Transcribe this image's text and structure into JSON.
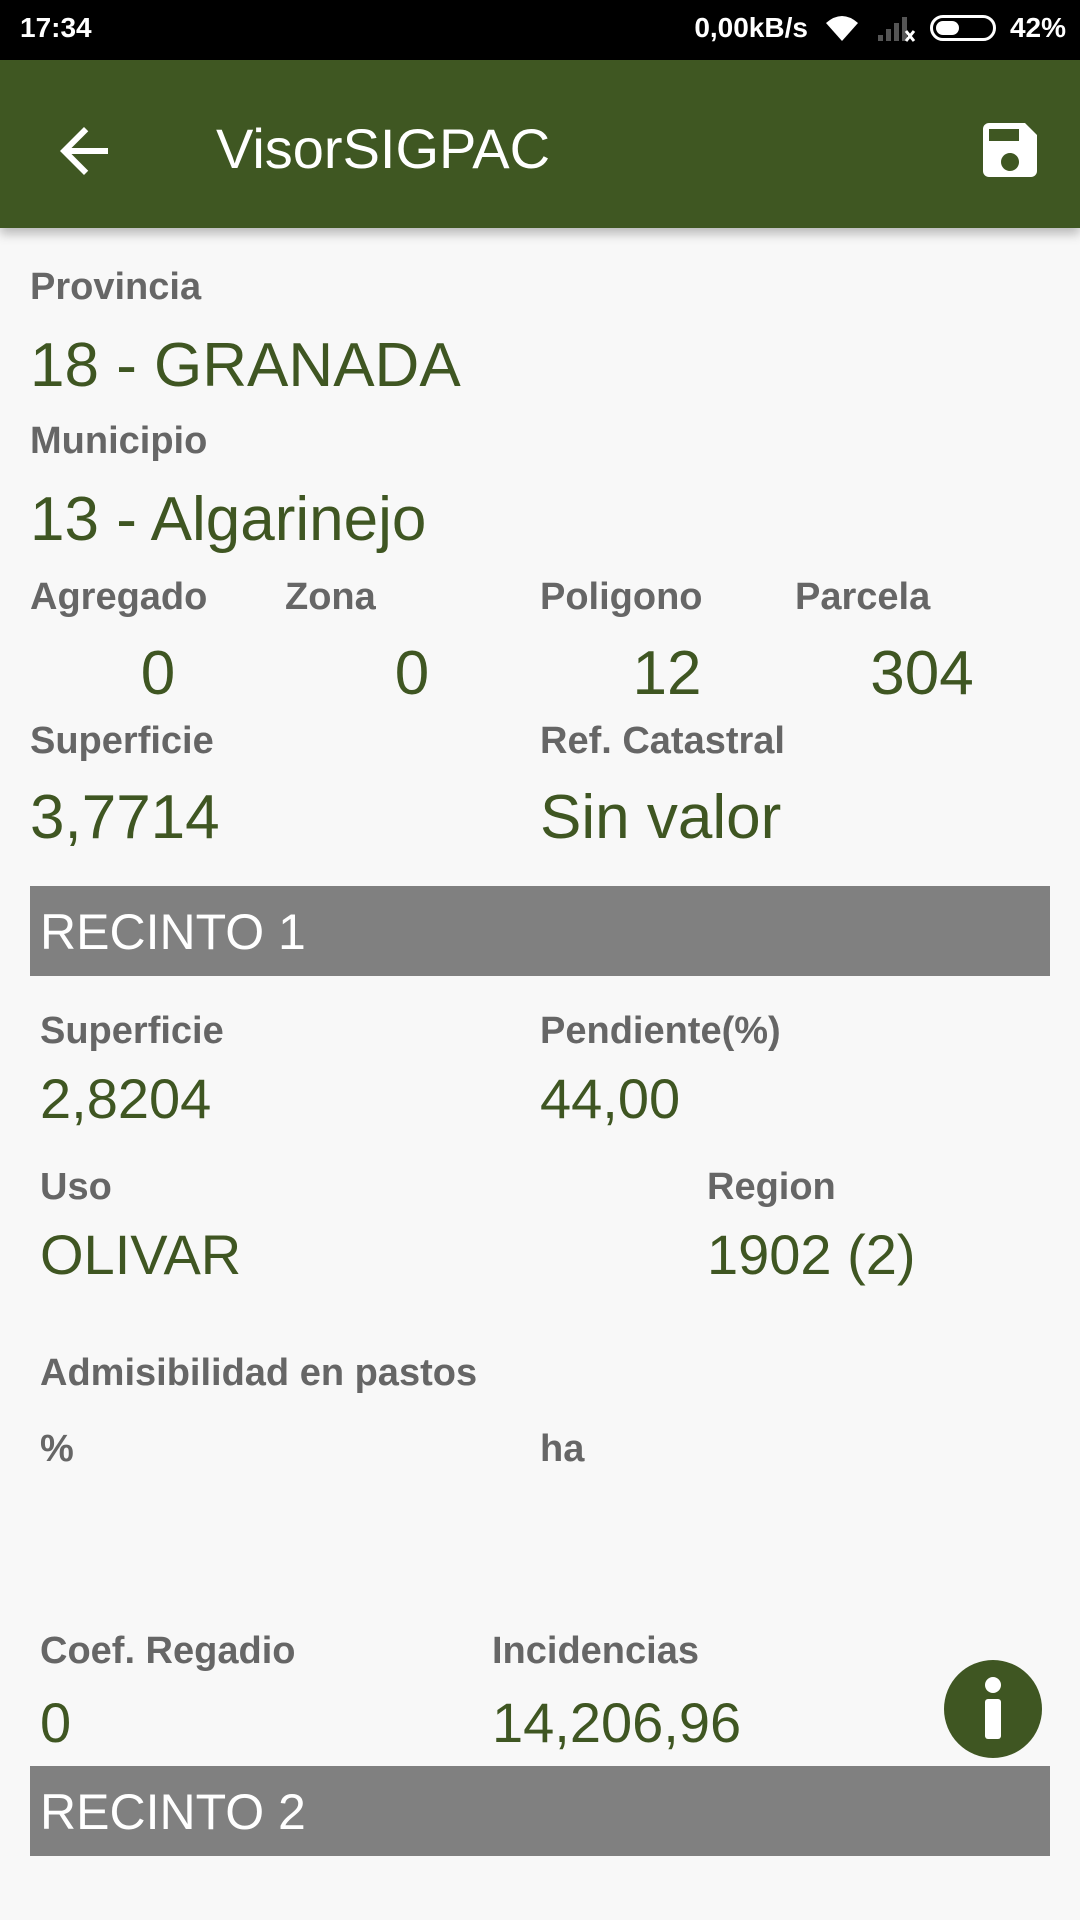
{
  "status_bar": {
    "time": "17:34",
    "network_speed": "0,00kB/s",
    "battery_percent": "42%",
    "battery_level": 0.42,
    "icons": [
      "wifi-icon",
      "signal-icon",
      "battery-icon"
    ]
  },
  "app_bar": {
    "title": "VisorSIGPAC",
    "back_icon": "arrow-back-icon",
    "save_icon": "save-icon"
  },
  "parcela": {
    "provincia_label": "Provincia",
    "provincia_value": "18 - GRANADA",
    "municipio_label": "Municipio",
    "municipio_value": "13 - Algarinejo",
    "agregado_label": "Agregado",
    "agregado_value": "0",
    "zona_label": "Zona",
    "zona_value": "0",
    "poligono_label": "Poligono",
    "poligono_value": "12",
    "parcela_label": "Parcela",
    "parcela_value": "304",
    "superficie_label": "Superficie",
    "superficie_value": "3,7714",
    "ref_catastral_label": "Ref. Catastral",
    "ref_catastral_value": "Sin valor"
  },
  "recinto1": {
    "header": "RECINTO 1",
    "superficie_label": "Superficie",
    "superficie_value": "2,8204",
    "pendiente_label": "Pendiente(%)",
    "pendiente_value": "44,00",
    "uso_label": "Uso",
    "uso_value": "OLIVAR",
    "region_label": "Region",
    "region_value": "1902 (2)",
    "admisibilidad_label": "Admisibilidad en pastos",
    "percent_label": "%",
    "ha_label": "ha",
    "coef_regadio_label": "Coef. Regadio",
    "coef_regadio_value": "0",
    "incidencias_label": "Incidencias",
    "incidencias_value": "14,206,96",
    "info_icon": "info-icon"
  },
  "recinto2": {
    "header": "RECINTO 2"
  },
  "colors": {
    "app_bar": "#3f5722",
    "value_text": "#3f5622",
    "label_text": "#666666",
    "section_band": "#808080"
  }
}
